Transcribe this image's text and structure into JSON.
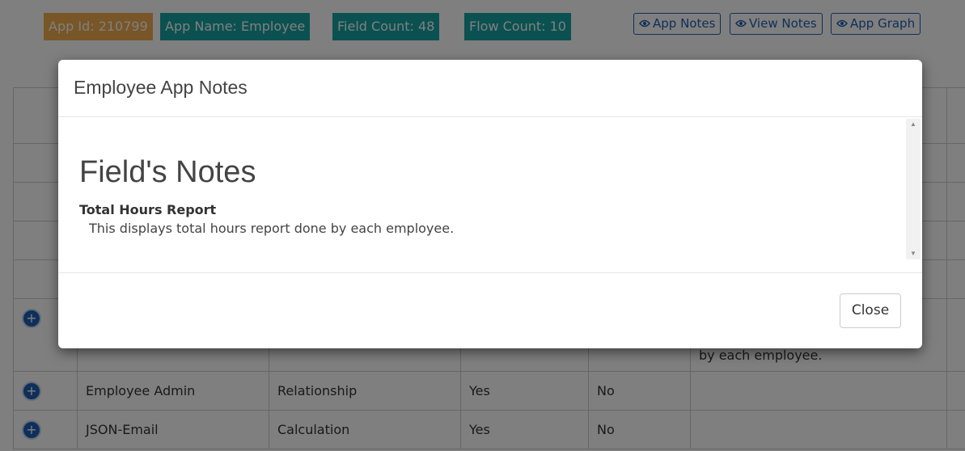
{
  "badges": {
    "app_id": "App Id: 210799",
    "app_name": "App Name: Employee",
    "field_count": "Field Count: 48",
    "flow_count": "Flow Count: 10"
  },
  "top_buttons": {
    "app_notes": "App Notes",
    "view_notes": "View Notes",
    "app_graph": "App Graph"
  },
  "table": {
    "rows": [
      {
        "name": "",
        "type": "",
        "col3": "",
        "col4": "",
        "notes": "by each employee."
      },
      {
        "name": "Employee Admin",
        "type": "Relationship",
        "col3": "Yes",
        "col4": "No",
        "notes": ""
      },
      {
        "name": "JSON-Email",
        "type": "Calculation",
        "col3": "Yes",
        "col4": "No",
        "notes": ""
      }
    ]
  },
  "modal": {
    "title": "Employee App Notes",
    "heading": "Field's Notes",
    "field_name": "Total Hours Report",
    "field_note": "This displays total hours report done by each employee.",
    "close_label": "Close"
  },
  "icons": {
    "eye": "eye-icon",
    "add": "plus-circle-icon"
  },
  "colors": {
    "badge_orange": "#f0ad4e",
    "badge_teal": "#17a2a2",
    "link_blue": "#1e5fb5"
  }
}
